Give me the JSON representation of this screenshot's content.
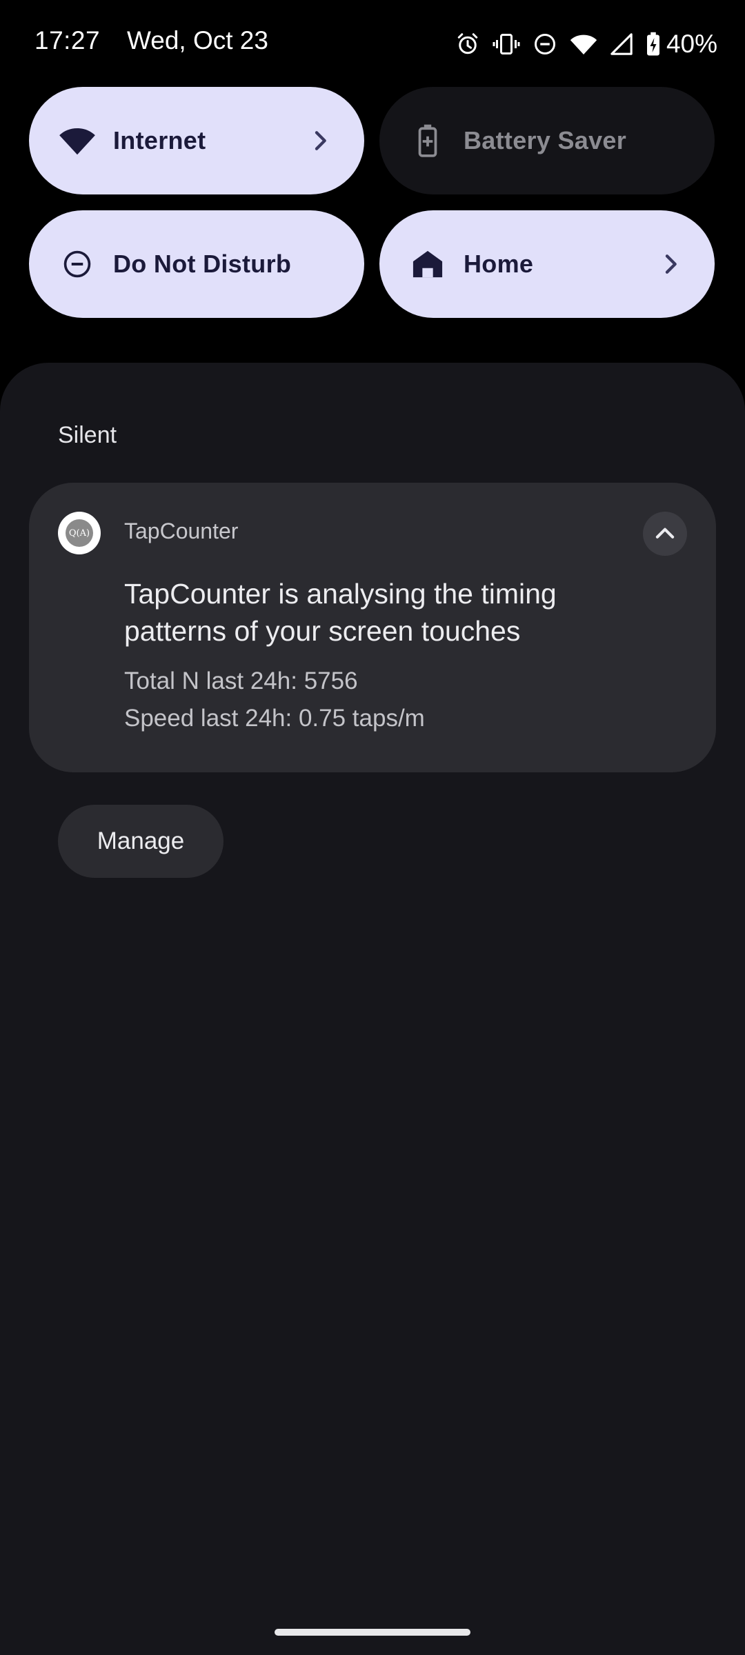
{
  "status_bar": {
    "time": "17:27",
    "date": "Wed, Oct 23",
    "battery_percent": "40%",
    "icons": [
      "alarm-icon",
      "vibrate-icon",
      "dnd-icon",
      "wifi-icon",
      "cell-signal-icon",
      "battery-charging-icon"
    ]
  },
  "quick_settings": {
    "tiles": [
      {
        "label": "Internet",
        "icon": "wifi-icon",
        "state": "on",
        "has_chevron": true
      },
      {
        "label": "Battery Saver",
        "icon": "battery-plus-icon",
        "state": "off",
        "has_chevron": false
      },
      {
        "label": "Do Not Disturb",
        "icon": "dnd-icon",
        "state": "on",
        "has_chevron": false
      },
      {
        "label": "Home",
        "icon": "home-icon",
        "state": "on",
        "has_chevron": true
      }
    ]
  },
  "notifications": {
    "section_title": "Silent",
    "items": [
      {
        "app_name": "TapCounter",
        "icon_text": "Q(A)",
        "title": "TapCounter is analysing the timing patterns of your screen touches",
        "lines": [
          "Total N last 24h: 5756",
          "Speed last 24h: 0.75 taps/m"
        ],
        "expanded": true
      }
    ],
    "manage_label": "Manage"
  },
  "colors": {
    "tile_on": "#e1e0fa",
    "tile_off": "#141418",
    "shade_bg": "#16161b",
    "card_bg": "#2b2b30"
  }
}
